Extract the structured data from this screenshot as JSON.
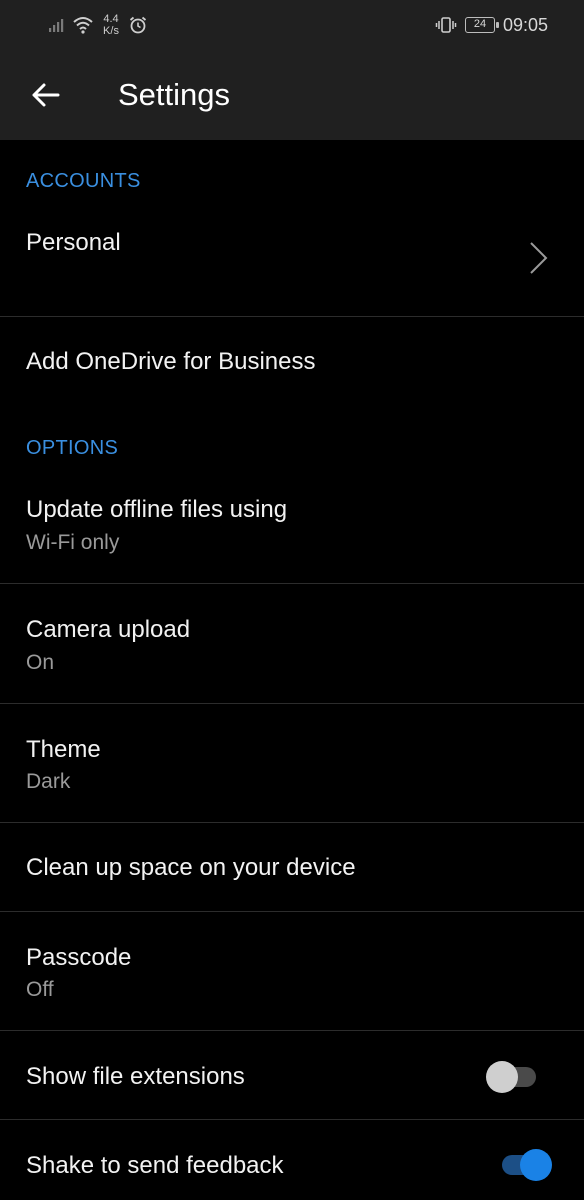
{
  "status_bar": {
    "speed_value": "4.4",
    "speed_unit": "K/s",
    "battery": "24",
    "time": "09:05"
  },
  "app_bar": {
    "title": "Settings"
  },
  "sections": {
    "accounts": "ACCOUNTS",
    "options": "OPTIONS"
  },
  "accounts": {
    "personal": "Personal",
    "add_business": "Add OneDrive for Business"
  },
  "options": {
    "update_offline": {
      "title": "Update offline files using",
      "value": "Wi-Fi only"
    },
    "camera_upload": {
      "title": "Camera upload",
      "value": "On"
    },
    "theme": {
      "title": "Theme",
      "value": "Dark"
    },
    "clean_up": {
      "title": "Clean up space on your device"
    },
    "passcode": {
      "title": "Passcode",
      "value": "Off"
    },
    "file_extensions": {
      "title": "Show file extensions",
      "enabled": false
    },
    "shake_feedback": {
      "title": "Shake to send feedback",
      "enabled": true
    }
  },
  "colors": {
    "accent": "#3a8fe0",
    "background": "#000000",
    "bar": "#202020",
    "toggle_on": "#1a82e6"
  },
  "icons": {
    "back": "arrow-left-icon",
    "chevron": "chevron-right-icon",
    "signal": "signal-icon",
    "wifi": "wifi-icon",
    "alarm": "alarm-icon",
    "vibrate": "vibrate-icon",
    "battery": "battery-icon"
  }
}
